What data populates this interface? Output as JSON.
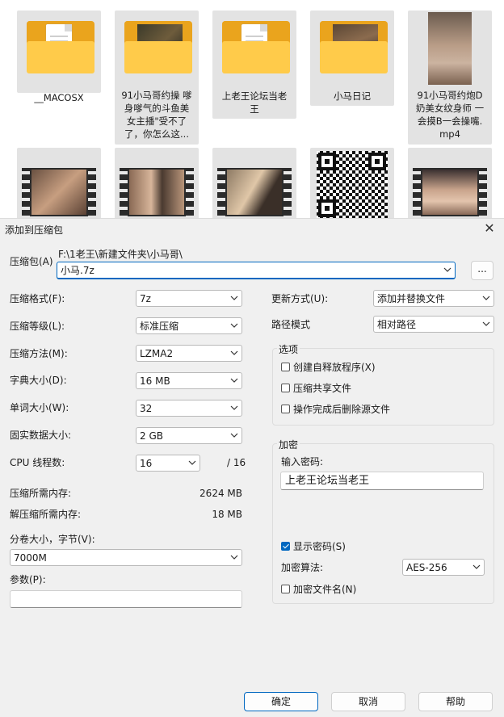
{
  "explorer": {
    "items": [
      {
        "label": "__MACOSX",
        "kind": "folder-doc"
      },
      {
        "label": "91小马哥约操 嗲\n身嗲气的斗鱼美\n女主播\"受不了\n了，你怎么这...",
        "kind": "folder-img"
      },
      {
        "label": "上老王论坛当老\n王",
        "kind": "folder-doc"
      },
      {
        "label": "小马日记",
        "kind": "folder-img"
      },
      {
        "label": "91小马哥约炮D\n奶美女纹身师 一\n会摸B一会操嘴.\nmp4",
        "kind": "photo"
      }
    ]
  },
  "dialog": {
    "title": "添加到压缩包",
    "close_symbol": "✕",
    "archive_label": "压缩包(A)",
    "archive_dir": "F:\\1老王\\新建文件夹\\小马哥\\",
    "archive_name": "小马.7z",
    "browse_label": "...",
    "left": {
      "format_label": "压缩格式(F):",
      "format_value": "7z",
      "level_label": "压缩等级(L):",
      "level_value": "标准压缩",
      "method_label": "压缩方法(M):",
      "method_value": "LZMA2",
      "dict_label": "字典大小(D):",
      "dict_value": "16 MB",
      "word_label": "单词大小(W):",
      "word_value": "32",
      "solid_label": "固实数据大小:",
      "solid_value": "2 GB",
      "threads_label": "CPU 线程数:",
      "threads_value": "16",
      "threads_total": "/ 16",
      "mem_comp_label": "压缩所需内存:",
      "mem_comp_value": "2624 MB",
      "mem_decomp_label": "解压缩所需内存:",
      "mem_decomp_value": "18 MB",
      "volume_label": "分卷大小，字节(V):",
      "volume_value": "7000M",
      "params_label": "参数(P):",
      "params_value": ""
    },
    "right": {
      "update_label": "更新方式(U):",
      "update_value": "添加并替换文件",
      "path_label": "路径模式",
      "path_value": "相对路径",
      "options_title": "选项",
      "options": [
        {
          "label": "创建自释放程序(X)",
          "checked": false
        },
        {
          "label": "压缩共享文件",
          "checked": false
        },
        {
          "label": "操作完成后删除源文件",
          "checked": false
        }
      ],
      "encrypt_title": "加密",
      "password_label": "输入密码:",
      "password_value": "上老王论坛当老王",
      "show_password_label": "显示密码(S)",
      "show_password_checked": true,
      "algo_label": "加密算法:",
      "algo_value": "AES-256",
      "encrypt_names_label": "加密文件名(N)",
      "encrypt_names_checked": false
    },
    "buttons": {
      "ok": "确定",
      "cancel": "取消",
      "help": "帮助"
    }
  },
  "colors": {
    "accent": "#0067c0",
    "folder": "#ffcb4a",
    "dialog_bg": "#f0f0f0"
  }
}
